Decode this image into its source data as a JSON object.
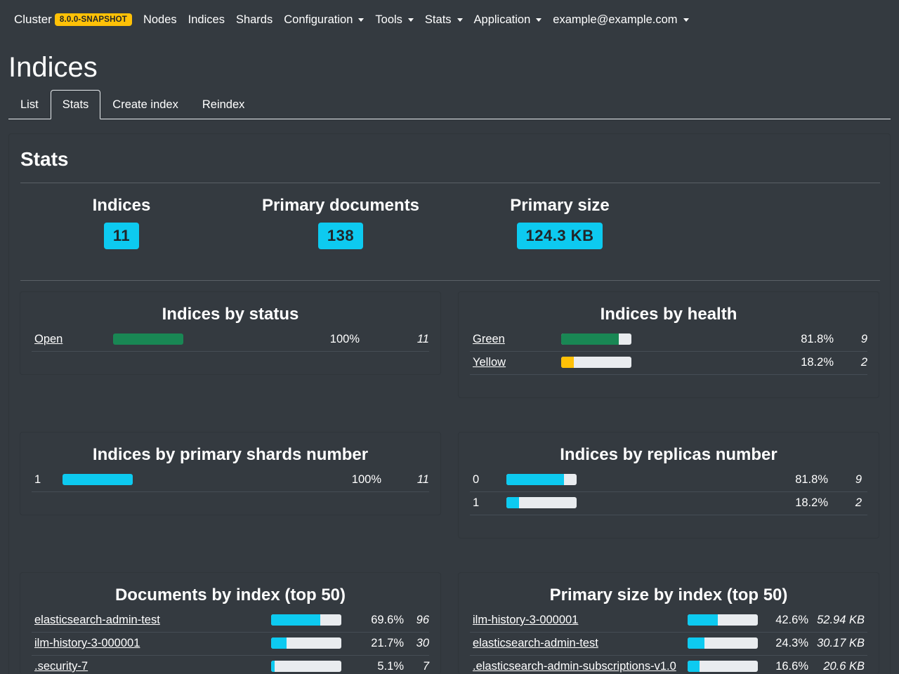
{
  "navbar": {
    "brand": "Cluster",
    "version_badge": "8.0.0-SNAPSHOT",
    "items": [
      {
        "label": "Nodes",
        "dropdown": false
      },
      {
        "label": "Indices",
        "dropdown": false
      },
      {
        "label": "Shards",
        "dropdown": false
      },
      {
        "label": "Configuration",
        "dropdown": true
      },
      {
        "label": "Tools",
        "dropdown": true
      },
      {
        "label": "Stats",
        "dropdown": true
      },
      {
        "label": "Application",
        "dropdown": true
      },
      {
        "label": "example@example.com",
        "dropdown": true
      }
    ]
  },
  "page_title": "Indices",
  "tabs": [
    {
      "label": "List",
      "active": false
    },
    {
      "label": "Stats",
      "active": true
    },
    {
      "label": "Create index",
      "active": false
    },
    {
      "label": "Reindex",
      "active": false
    }
  ],
  "stats": {
    "title": "Stats",
    "summary": [
      {
        "label": "Indices",
        "value": "11"
      },
      {
        "label": "Primary documents",
        "value": "138"
      },
      {
        "label": "Primary size",
        "value": "124.3 KB"
      }
    ]
  },
  "colors": {
    "success": "#198754",
    "warning": "#ffc107",
    "info": "#0dcaf0",
    "track": "#e9ecef"
  },
  "panels": {
    "status": {
      "title": "Indices by status",
      "rows": [
        {
          "label": "Open",
          "link": true,
          "fraction": 1.0,
          "pct": "100%",
          "count": "11",
          "color": "#198754"
        }
      ]
    },
    "health": {
      "title": "Indices by health",
      "rows": [
        {
          "label": "Green",
          "link": true,
          "fraction": 0.818,
          "pct": "81.8%",
          "count": "9",
          "color": "#198754"
        },
        {
          "label": "Yellow",
          "link": true,
          "fraction": 0.182,
          "pct": "18.2%",
          "count": "2",
          "color": "#ffc107"
        }
      ]
    },
    "shards": {
      "title": "Indices by primary shards number",
      "rows": [
        {
          "label": "1",
          "link": false,
          "fraction": 1.0,
          "pct": "100%",
          "count": "11",
          "color": "#0dcaf0"
        }
      ]
    },
    "replicas": {
      "title": "Indices by replicas number",
      "rows": [
        {
          "label": "0",
          "link": false,
          "fraction": 0.818,
          "pct": "81.8%",
          "count": "9",
          "color": "#0dcaf0"
        },
        {
          "label": "1",
          "link": false,
          "fraction": 0.182,
          "pct": "18.2%",
          "count": "2",
          "color": "#0dcaf0"
        }
      ]
    },
    "documents": {
      "title": "Documents by index (top 50)",
      "rows": [
        {
          "label": "elasticsearch-admin-test",
          "link": true,
          "fraction": 0.696,
          "pct": "69.6%",
          "count": "96",
          "color": "#0dcaf0"
        },
        {
          "label": "ilm-history-3-000001",
          "link": true,
          "fraction": 0.217,
          "pct": "21.7%",
          "count": "30",
          "color": "#0dcaf0"
        },
        {
          "label": ".security-7",
          "link": true,
          "fraction": 0.051,
          "pct": "5.1%",
          "count": "7",
          "color": "#0dcaf0"
        }
      ]
    },
    "size": {
      "title": "Primary size by index (top 50)",
      "rows": [
        {
          "label": "ilm-history-3-000001",
          "link": true,
          "fraction": 0.426,
          "pct": "42.6%",
          "count": "52.94 KB",
          "color": "#0dcaf0"
        },
        {
          "label": "elasticsearch-admin-test",
          "link": true,
          "fraction": 0.243,
          "pct": "24.3%",
          "count": "30.17 KB",
          "color": "#0dcaf0"
        },
        {
          "label": ".elasticsearch-admin-subscriptions-v1.0",
          "link": true,
          "fraction": 0.166,
          "pct": "16.6%",
          "count": "20.6 KB",
          "color": "#0dcaf0"
        }
      ]
    }
  }
}
